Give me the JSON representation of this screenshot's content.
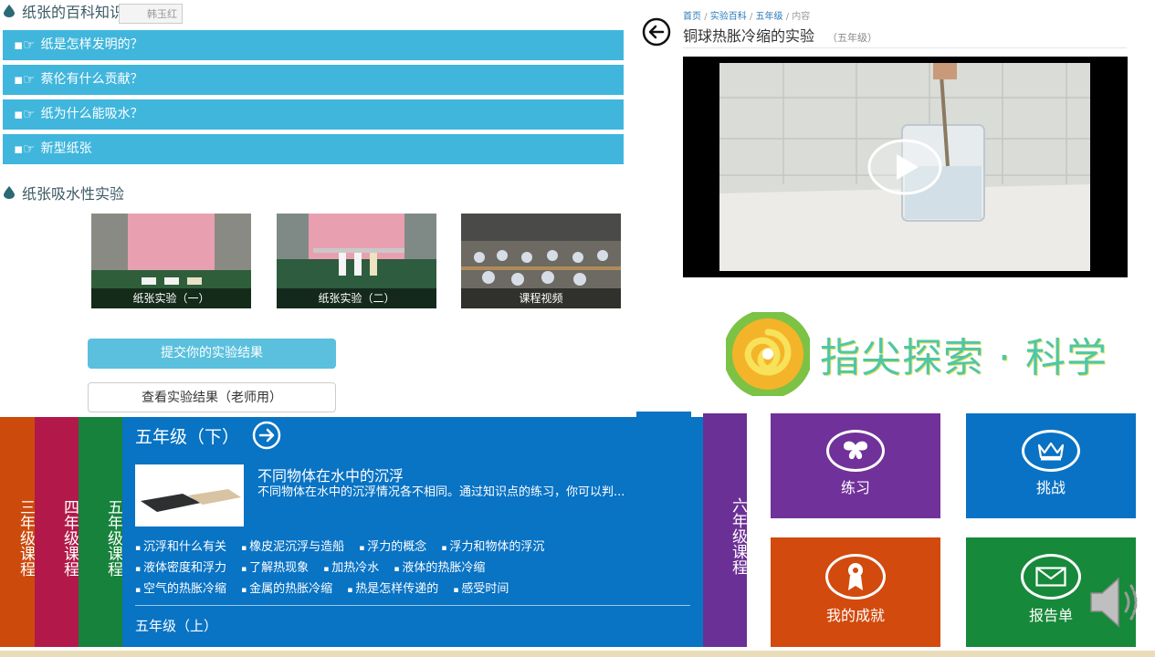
{
  "knowledge": {
    "section_title": "纸张的百科知识",
    "tag_stub": "韩玉红",
    "questions": [
      {
        "label": "纸是怎样发明的？"
      },
      {
        "label": "蔡伦有什么贡献？"
      },
      {
        "label": "纸为什么能吸水？"
      },
      {
        "label": "新型纸张"
      }
    ],
    "experiment_title": "纸张吸水性实验",
    "thumbs": [
      {
        "caption": "纸张实验（一）"
      },
      {
        "caption": "纸张实验（二）"
      },
      {
        "caption": "课程视频"
      }
    ],
    "submit_label": "提交你的实验结果",
    "view_label": "查看实验结果（老师用）"
  },
  "video": {
    "breadcrumb": {
      "home": "首页",
      "sep": "/",
      "section": "实验百科",
      "grade": "五年级",
      "current": "内容"
    },
    "title": "铜球热胀冷缩的实验",
    "grade_tag": "（五年级）"
  },
  "brand": {
    "name": "指尖探索 · 科学"
  },
  "grades": {
    "g3": "三年级课程",
    "g4": "四年级课程",
    "g5": "五年级课程",
    "g6": "六年级课程"
  },
  "course": {
    "term_title": "五年级（下）",
    "lesson_title": "不同物体在水中的沉浮",
    "lesson_desc": "不同物体在水中的沉浮情况各不相同。通过知识点的练习，你可以判...",
    "topics": [
      "沉浮和什么有关",
      "橡皮泥沉浮与造船",
      "浮力的概念",
      "浮力和物体的浮沉",
      "液体密度和浮力",
      "了解热现象",
      "加热冷水",
      "液体的热胀冷缩",
      "空气的热胀冷缩",
      "金属的热胀冷缩",
      "热是怎样传递的",
      "感受时间"
    ],
    "prev_term": "五年级（上）"
  },
  "tiles": {
    "practice": "练习",
    "challenge": "挑战",
    "achievements": "我的成就",
    "report": "报告单"
  },
  "colors": {
    "question_bg": "#40b6dc",
    "grade3": "#cc4a0b",
    "grade4": "#b2194a",
    "grade5": "#16823c",
    "grade6": "#6b3095",
    "course_bg": "#0973c4",
    "tile_practice": "#71319a",
    "tile_challenge": "#0a72c4",
    "tile_achievements": "#d24a0e",
    "tile_report": "#17893a"
  }
}
